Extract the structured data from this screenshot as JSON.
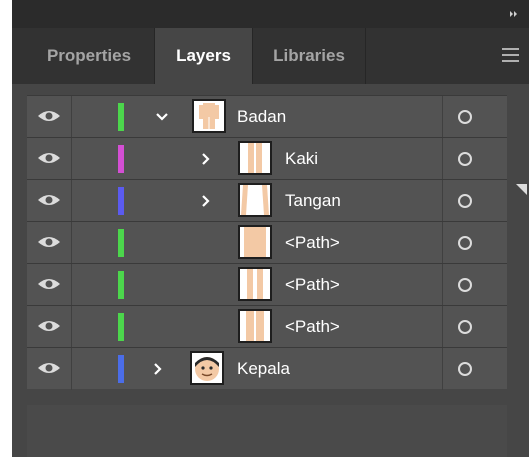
{
  "panel": {
    "tabs": [
      {
        "label": "Properties",
        "active": false
      },
      {
        "label": "Layers",
        "active": true
      },
      {
        "label": "Libraries",
        "active": false
      }
    ]
  },
  "colors": {
    "green": "#4cd64c",
    "magenta": "#d44fd4",
    "blue": "#5b5bf0",
    "blue2": "#4b6de8",
    "skin": "#f3c9a5"
  },
  "layers": [
    {
      "name": "Badan",
      "level": 0,
      "expanded": true,
      "color": "green",
      "visible": true
    },
    {
      "name": "Kaki",
      "level": 1,
      "expanded": false,
      "color": "magenta",
      "visible": true
    },
    {
      "name": "Tangan",
      "level": 1,
      "expanded": false,
      "color": "blue",
      "visible": true
    },
    {
      "name": "<Path>",
      "level": 1,
      "color": "green",
      "visible": true
    },
    {
      "name": "<Path>",
      "level": 1,
      "color": "green",
      "visible": true
    },
    {
      "name": "<Path>",
      "level": 1,
      "color": "green",
      "visible": true
    },
    {
      "name": "Kepala",
      "level": 0,
      "expanded": false,
      "color": "blue2",
      "visible": true
    }
  ]
}
